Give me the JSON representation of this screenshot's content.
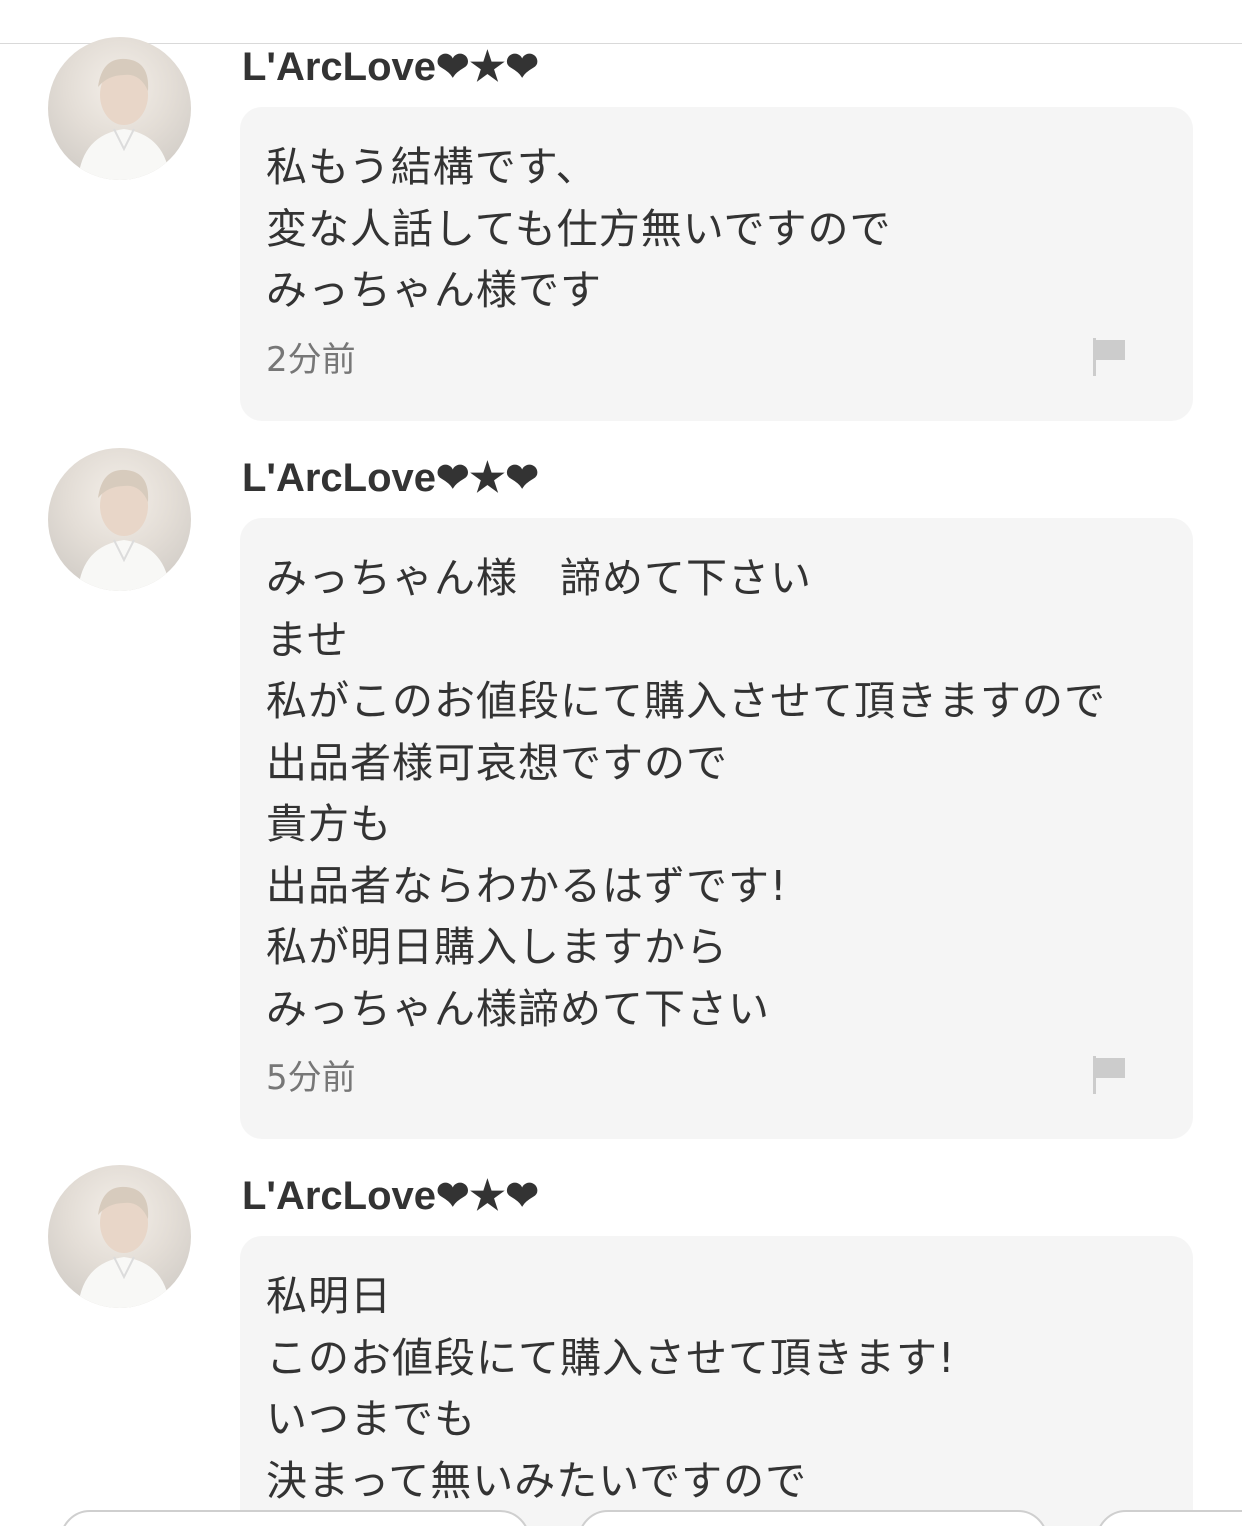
{
  "comments": [
    {
      "username": "L'ArcLove❤︎★❤︎",
      "lines": [
        "私もう結構です、",
        "変な人話しても仕方無いですので",
        "みっちゃん様です"
      ],
      "timestamp": "2分前",
      "icons": {
        "avatar": "user-avatar",
        "report": "flag-icon"
      }
    },
    {
      "username": "L'ArcLove❤︎★❤︎",
      "lines": [
        "みっちゃん様　諦めて下さい",
        "ませ",
        "私がこのお値段にて購入させて頂きますので",
        "出品者様可哀想ですので",
        "貴方も",
        "出品者ならわかるはずです!",
        "私が明日購入しますから",
        "みっちゃん様諦めて下さい"
      ],
      "timestamp": "5分前",
      "icons": {
        "avatar": "user-avatar",
        "report": "flag-icon"
      }
    },
    {
      "username": "L'ArcLove❤︎★❤︎",
      "lines": [
        "私明日",
        "このお値段にて購入させて頂きます!",
        "いつまでも",
        "決まって無いみたいですので"
      ],
      "timestamp": "",
      "icons": {
        "avatar": "user-avatar",
        "report": "flag-icon"
      }
    }
  ],
  "colors": {
    "bubble_background": "#f5f5f5",
    "text": "#333333",
    "timestamp": "#777777",
    "flag": "#cccccc"
  }
}
